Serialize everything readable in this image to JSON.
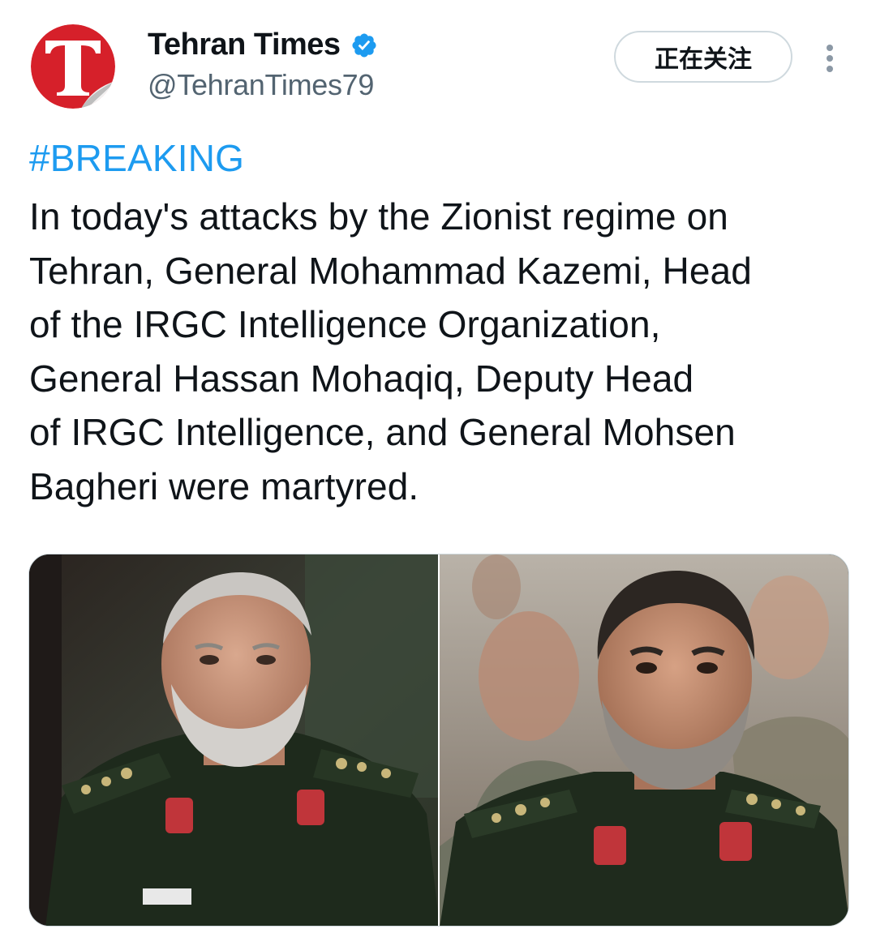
{
  "account": {
    "display_name": "Tehran Times",
    "handle": "@TehranTimes79",
    "avatar_letter": "T",
    "avatar_color": "#d6202a",
    "verified_icon": "verified-badge-icon",
    "verified_color": "#1d9bf0"
  },
  "actions": {
    "follow_label": "正在关注",
    "more_icon": "more-vertical-icon"
  },
  "tweet": {
    "hashtag": "#BREAKING",
    "hashtag_color": "#1d9bf0",
    "lines": [
      "In today's attacks by the Zionist regime on",
      "Tehran, General Mohammad Kazemi, Head",
      "of the IRGC Intelligence Organization,",
      "General Hassan Mohaqiq, Deputy Head",
      "of IRGC Intelligence, and General Mohsen",
      "Bagheri were martyred."
    ]
  },
  "media": {
    "photos": [
      {
        "subject": "older general with gray beard in dark green IRGC uniform"
      },
      {
        "subject": "general with dark hair and gray beard in IRGC uniform, crowd behind"
      }
    ]
  }
}
